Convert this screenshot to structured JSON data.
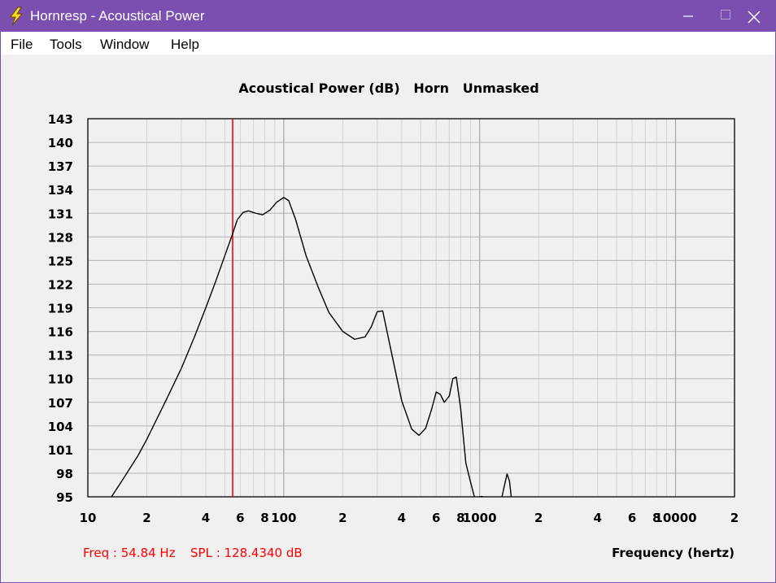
{
  "window": {
    "title": "Hornresp - Acoustical Power",
    "accent": "#7a4fb0",
    "icon": "lightning-bolt-icon",
    "controls": [
      "minimize-icon",
      "maximize-icon",
      "close-icon"
    ]
  },
  "menu": {
    "items": [
      "File",
      "Tools",
      "Window",
      "Help"
    ]
  },
  "status": {
    "freq": "Freq : 54.84 Hz",
    "spl": "SPL : 128.4340 dB",
    "color": "#ff0000"
  },
  "chart_data": {
    "type": "line",
    "title": "Acoustical Power (dB)   Horn   Unmasked",
    "xlabel": "Frequency (hertz)",
    "ylabel": "",
    "x_scale": "log",
    "xlim": [
      10,
      20000
    ],
    "ylim": [
      95,
      143
    ],
    "yticks": [
      95,
      98,
      101,
      104,
      107,
      110,
      113,
      116,
      119,
      122,
      125,
      128,
      131,
      134,
      137,
      140,
      143
    ],
    "xtick_labels": [
      {
        "x": 10,
        "label": "10"
      },
      {
        "x": 20,
        "label": "2"
      },
      {
        "x": 40,
        "label": "4"
      },
      {
        "x": 60,
        "label": "6"
      },
      {
        "x": 80,
        "label": "8"
      },
      {
        "x": 100,
        "label": "100"
      },
      {
        "x": 200,
        "label": "2"
      },
      {
        "x": 400,
        "label": "4"
      },
      {
        "x": 600,
        "label": "6"
      },
      {
        "x": 800,
        "label": "8"
      },
      {
        "x": 1000,
        "label": "1000"
      },
      {
        "x": 2000,
        "label": "2"
      },
      {
        "x": 4000,
        "label": "4"
      },
      {
        "x": 6000,
        "label": "6"
      },
      {
        "x": 8000,
        "label": "8"
      },
      {
        "x": 10000,
        "label": "10000"
      },
      {
        "x": 20000,
        "label": "2"
      }
    ],
    "grid": true,
    "cursor": {
      "x": 54.84,
      "color": "#ff0000"
    },
    "series": [
      {
        "color": "#000000",
        "points": [
          [
            13.2,
            95.0
          ],
          [
            15,
            97.1
          ],
          [
            18,
            100.2
          ],
          [
            20,
            102.3
          ],
          [
            25,
            107.2
          ],
          [
            30,
            111.3
          ],
          [
            35,
            115.3
          ],
          [
            40,
            119.0
          ],
          [
            45,
            122.4
          ],
          [
            50,
            125.6
          ],
          [
            54.84,
            128.4
          ],
          [
            58,
            130.2
          ],
          [
            62,
            131.1
          ],
          [
            66,
            131.3
          ],
          [
            72,
            131.0
          ],
          [
            78,
            130.8
          ],
          [
            85,
            131.4
          ],
          [
            92,
            132.4
          ],
          [
            100,
            133.0
          ],
          [
            106,
            132.6
          ],
          [
            115,
            130.2
          ],
          [
            130,
            125.6
          ],
          [
            150,
            121.6
          ],
          [
            170,
            118.4
          ],
          [
            200,
            116.0
          ],
          [
            230,
            115.0
          ],
          [
            260,
            115.3
          ],
          [
            280,
            116.6
          ],
          [
            300,
            118.5
          ],
          [
            320,
            118.6
          ],
          [
            350,
            114.0
          ],
          [
            400,
            107.2
          ],
          [
            450,
            103.6
          ],
          [
            490,
            102.8
          ],
          [
            530,
            103.7
          ],
          [
            570,
            106.2
          ],
          [
            600,
            108.3
          ],
          [
            630,
            108.0
          ],
          [
            660,
            107.0
          ],
          [
            700,
            107.8
          ],
          [
            730,
            110.0
          ],
          [
            760,
            110.2
          ],
          [
            800,
            106.2
          ],
          [
            850,
            99.3
          ],
          [
            900,
            96.8
          ],
          [
            940,
            95.0
          ]
        ]
      },
      {
        "color": "#000000",
        "points": [
          [
            1000,
            95.0
          ],
          [
            1020,
            95.05
          ],
          [
            1040,
            95.0
          ]
        ]
      },
      {
        "color": "#000000",
        "points": [
          [
            1300,
            95.0
          ],
          [
            1340,
            96.5
          ],
          [
            1380,
            97.9
          ],
          [
            1420,
            97.0
          ],
          [
            1450,
            95.0
          ]
        ]
      }
    ]
  }
}
